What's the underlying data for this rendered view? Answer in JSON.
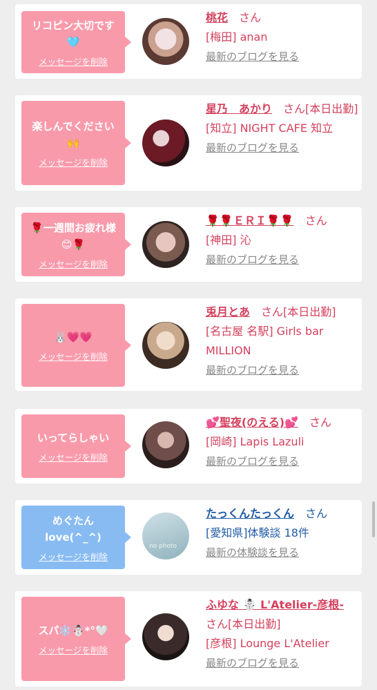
{
  "delete_label": "メッセージを削除",
  "blog_link": "最新のブログを見る",
  "review_link": "最新の体験談を見る",
  "honorific": "さん",
  "cards": [
    {
      "message": "リコピン大切です 🩵",
      "name": "桃花",
      "suffix": "さん",
      "place": "[梅田] anan",
      "link": "最新のブログを見る"
    },
    {
      "message": "楽しんでください 🙌",
      "name": "星乃　あかり",
      "suffix": "さん[本日出勤]",
      "place": "[知立] NIGHT CAFE 知立",
      "link": "最新のブログを見る"
    },
    {
      "message": "🌹一週間お疲れ様😊🌹",
      "name": "🌹🌹ＥＲＩ🌹🌹",
      "suffix": "さん",
      "place": "[神田] 沁",
      "link": "最新のブログを見る"
    },
    {
      "message": "🐰💗💗",
      "name": "兎月とあ",
      "suffix": "さん[本日出勤]",
      "place": "[名古屋 名駅] Girls bar MILLION",
      "link": "最新のブログを見る"
    },
    {
      "message": "いってらしゃい",
      "name": "💕聖夜(のえる)💕",
      "suffix": "さん",
      "place": "[岡崎] Lapis Lazuli",
      "link": "最新のブログを見る"
    },
    {
      "message": "めぐたん love(^_^)",
      "name": "たっくんたっくん",
      "suffix": "さん",
      "place": "[愛知県]体験談 18件",
      "link": "最新の体験談を見る",
      "avatar_text": "no photo"
    },
    {
      "message": "スパ❄️☃️*°🤍",
      "name": "ふゆな ☃️ L'Atelier-彦根-",
      "suffix": "さん[本日出勤]",
      "place": "[彦根] Lounge L'Atelier",
      "link": "最新のブログを見る"
    }
  ],
  "colors": {
    "pink": "#f99aab",
    "blue": "#88bbf2",
    "name": "#d4405c",
    "name_blue": "#1f5aa6"
  }
}
